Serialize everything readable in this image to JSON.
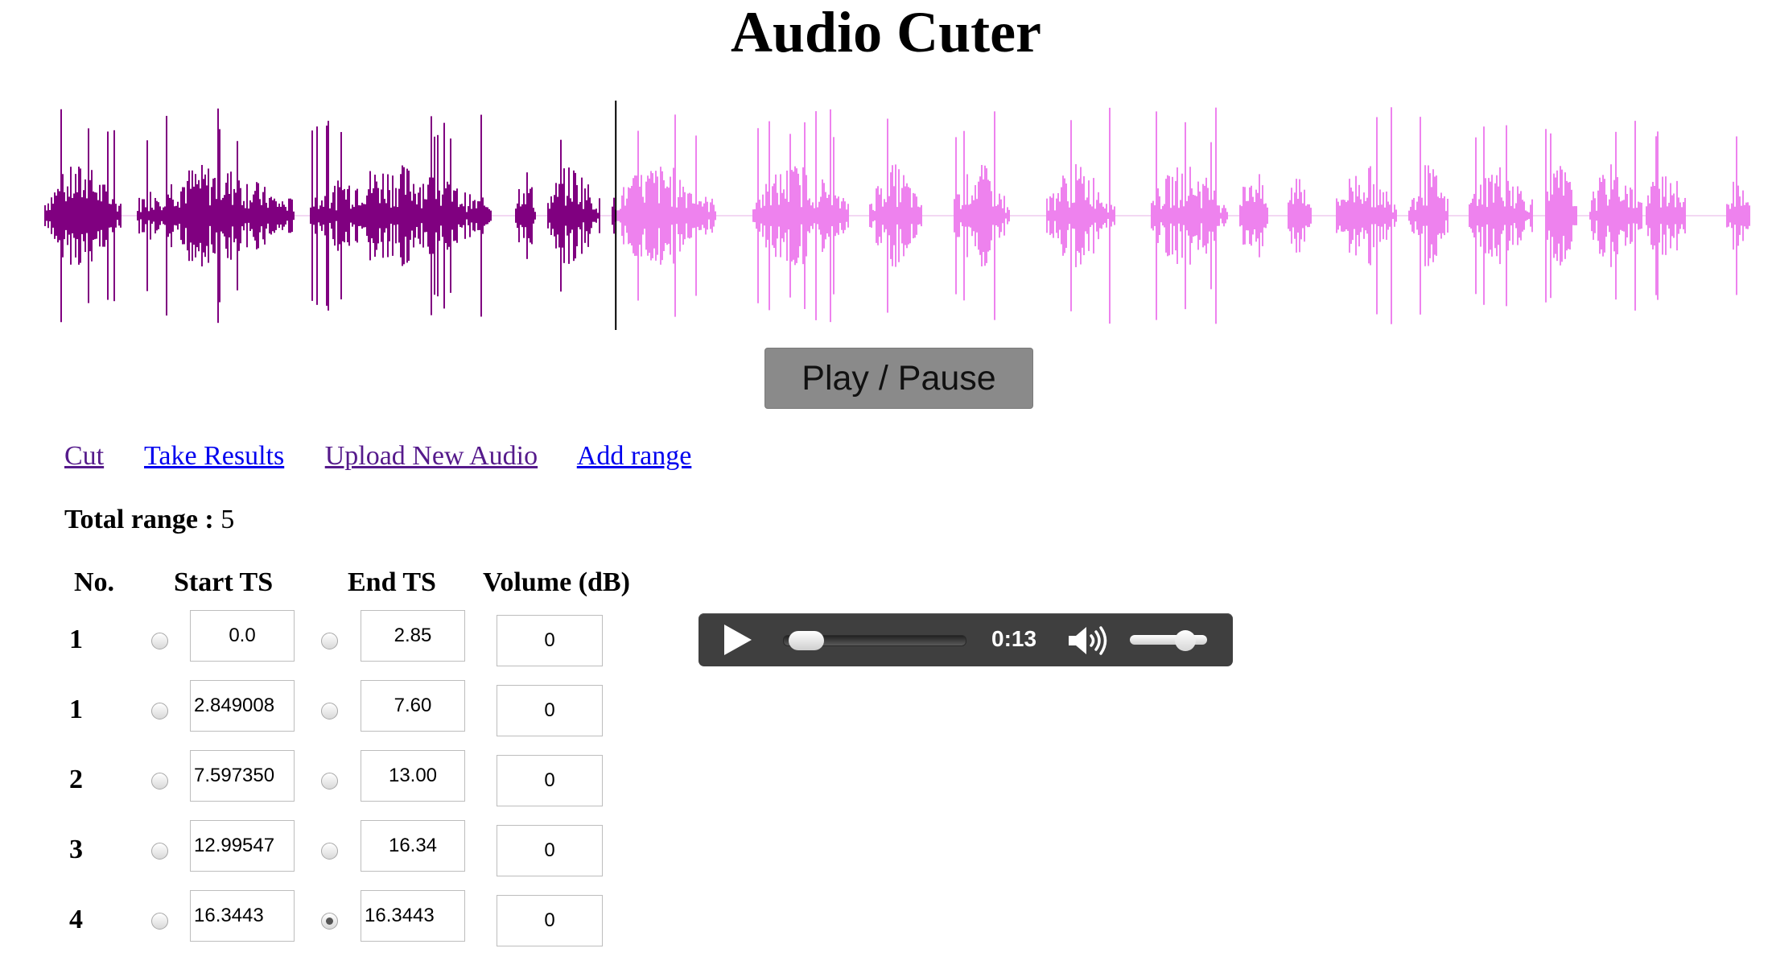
{
  "app": {
    "title": "Audio Cuter"
  },
  "waveform": {
    "played_color": "#800080",
    "unplayed_color": "#ee82ee",
    "cursor_color": "#000000",
    "playback_fraction": 0.335
  },
  "controls": {
    "play_pause_label": "Play / Pause"
  },
  "links": {
    "cut": "Cut",
    "take_results": "Take Results",
    "upload": "Upload New Audio",
    "add_range": "Add range"
  },
  "summary": {
    "label": "Total range :",
    "value": "5"
  },
  "table": {
    "headers": [
      "No.",
      "Start TS",
      "End TS",
      "Volume (dB)"
    ],
    "rows": [
      {
        "no": "1",
        "start": "0.0",
        "end": "2.85",
        "volume": "0",
        "start_selected": false,
        "end_selected": false
      },
      {
        "no": "1",
        "start": "2.849008",
        "end": "7.60",
        "volume": "0",
        "start_selected": false,
        "end_selected": false
      },
      {
        "no": "2",
        "start": "7.597350",
        "end": "13.00",
        "volume": "0",
        "start_selected": false,
        "end_selected": false
      },
      {
        "no": "3",
        "start": "12.99547",
        "end": "16.34",
        "volume": "0",
        "start_selected": false,
        "end_selected": false
      },
      {
        "no": "4",
        "start": "16.3443",
        "end": "16.3443",
        "volume": "0",
        "start_selected": false,
        "end_selected": true
      }
    ]
  },
  "player": {
    "current_time": "0:13",
    "progress": 0.05,
    "volume_level": 0.8
  }
}
